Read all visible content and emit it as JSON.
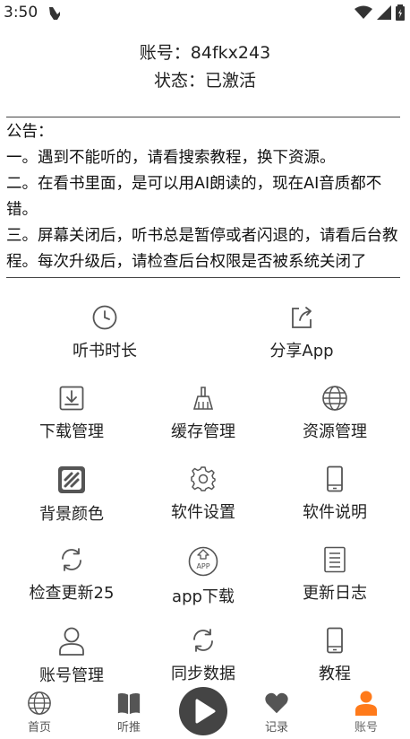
{
  "status_bar": {
    "time": "3:50"
  },
  "account": {
    "id_line": "账号：84fkx243",
    "status_line": "状态：已激活"
  },
  "notice": {
    "title": "公告：",
    "line1": "一。遇到不能听的，请看搜索教程，换下资源。",
    "line2": "二。在看书里面，是可以用AI朗读的，现在AI音质都不错。",
    "line3": "三。屏幕关闭后，听书总是暂停或者闪退的，请看后台教程。每次升级后，请检查后台权限是否被系统关闭了"
  },
  "menu": {
    "listen_duration": "听书时长",
    "share_app": "分享App",
    "download_manage": "下载管理",
    "cache_manage": "缓存管理",
    "resource_manage": "资源管理",
    "background_color": "背景颜色",
    "software_settings": "软件设置",
    "software_guide": "软件说明",
    "check_update": "检查更新25",
    "app_download": "app下载",
    "update_log": "更新日志",
    "account_manage": "账号管理",
    "sync_data": "同步数据",
    "tutorial": "教程",
    "app_icon_text": "APP"
  },
  "bottom_nav": {
    "home": "首页",
    "recommend": "听推",
    "records": "记录",
    "account": "账号"
  },
  "colors": {
    "active_accent": "#ff7a1a",
    "icon_gray": "#555555"
  }
}
